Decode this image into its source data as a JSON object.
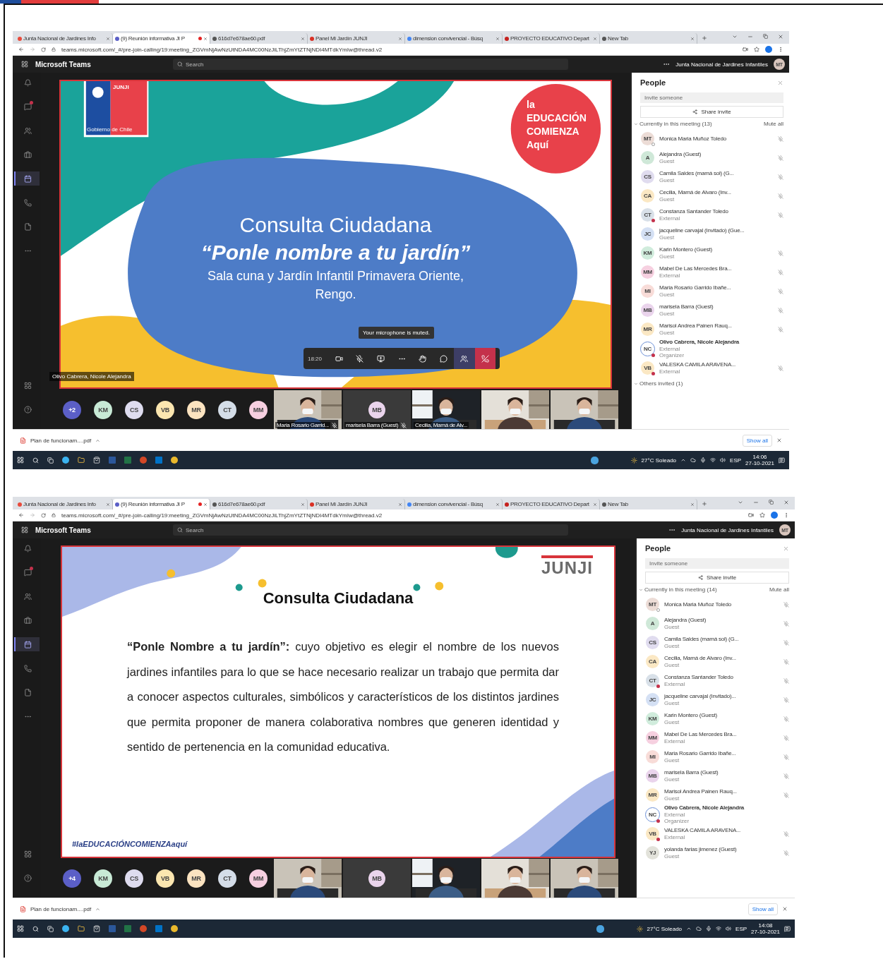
{
  "screens": [
    {
      "tabs": [
        {
          "title": "Junta Nacional de Jardines Info",
          "selected": false,
          "recording": false
        },
        {
          "title": "(9) Reunión informativa JI P",
          "selected": true,
          "recording": true
        },
        {
          "title": "616d7e678ae60.pdf",
          "selected": false,
          "recording": false
        },
        {
          "title": "Panel Mi Jardín JUNJI",
          "selected": false,
          "recording": false
        },
        {
          "title": "dimension convivencial - Búsq",
          "selected": false,
          "recording": false
        },
        {
          "title": "PROYECTO EDUCATIVO Depart",
          "selected": false,
          "recording": false
        },
        {
          "title": "New Tab",
          "selected": false,
          "recording": false
        }
      ],
      "url": "teams.microsoft.com/_#/pre-join-calling/19:meeting_ZGVmNjAwNzUtNDA4MC00NzJiLThjZmYtZTNjNDI4MTdkYmIw@thread.v2",
      "app_title": "Microsoft Teams",
      "search_placeholder": "Search",
      "org": "Junta Nacional de Jardines Infantiles",
      "user_initials": "MT",
      "rail": [
        {
          "kind": "activity",
          "selected": false,
          "badge": false
        },
        {
          "kind": "chat",
          "selected": false,
          "badge": true
        },
        {
          "kind": "teams",
          "selected": false,
          "badge": false
        },
        {
          "kind": "assignments",
          "selected": false,
          "badge": false
        },
        {
          "kind": "calendar",
          "selected": true,
          "badge": false
        },
        {
          "kind": "calls",
          "selected": false,
          "badge": false
        },
        {
          "kind": "files",
          "selected": false,
          "badge": false
        },
        {
          "kind": "more",
          "selected": false,
          "badge": false
        }
      ],
      "rail_bottom": [
        {
          "kind": "apps",
          "selected": false,
          "badge": false
        },
        {
          "kind": "help",
          "selected": false,
          "badge": false
        }
      ],
      "slide": {
        "kind": "cover",
        "logo_title": "JUNJI",
        "logo_caption": "Gobierno de Chile",
        "slogan_lines": [
          "la",
          "EDUCACIÓN",
          "COMIENZA",
          "Aquí"
        ],
        "title": "Consulta Ciudadana",
        "subtitle": "“Ponle nombre a tu jardín”",
        "lines": [
          "Sala cuna y Jardín Infantil Primavera Oriente,",
          "Rengo."
        ]
      },
      "call_controls": {
        "timer": "18:20",
        "toast": "Your microphone is muted."
      },
      "presenter_label": "Olivo Cabrera, Nicole Alejandra",
      "strip": [
        {
          "kind": "overflow",
          "label": "+2"
        },
        {
          "kind": "avatar",
          "initials": "KM",
          "color": "#c8ead6"
        },
        {
          "kind": "avatar",
          "initials": "CS",
          "color": "#dedcef"
        },
        {
          "kind": "avatar",
          "initials": "VB",
          "color": "#fbe6b0"
        },
        {
          "kind": "avatar",
          "initials": "MR",
          "color": "#fbe3c0"
        },
        {
          "kind": "avatar",
          "initials": "CT",
          "color": "#d4dde8"
        },
        {
          "kind": "avatar",
          "initials": "MM",
          "color": "#f6cfe0"
        },
        {
          "kind": "video",
          "label": "Maria Rosario Garrid...",
          "muted": true
        },
        {
          "kind": "avatar_tile",
          "initials": "MB",
          "color": "#ead4ec",
          "label": "marisela Barra (Guest)",
          "muted": true
        },
        {
          "kind": "video",
          "label": "Cecilia, Mamá de Alv...",
          "muted": false
        },
        {
          "kind": "video"
        },
        {
          "kind": "video"
        }
      ],
      "people": {
        "title": "People",
        "invite_placeholder": "Invite someone",
        "share": "Share invite",
        "section": "Currently in this meeting (13)",
        "mute_all": "Mute all",
        "others": "Others invited (1)",
        "participants": [
          {
            "initials": "MT",
            "name": "Monica Maria Muñoz Toledo",
            "color": "#ecdcd6",
            "busy": false,
            "offline": true,
            "muted": true,
            "bold": false
          },
          {
            "initials": "A",
            "name": "Alejandra (Guest)",
            "roles": [
              "Guest"
            ],
            "color": "#cfe8d8",
            "busy": false,
            "offline": false,
            "muted": true,
            "bold": false
          },
          {
            "initials": "CS",
            "name": "Camila Saldes (mamá sol) (G...",
            "roles": [
              "Guest"
            ],
            "color": "#e0dcef",
            "busy": false,
            "offline": false,
            "muted": true,
            "bold": false
          },
          {
            "initials": "CA",
            "name": "Cecilia, Mamá de Alvaro (Inv...",
            "roles": [
              "Guest"
            ],
            "color": "#fbe8c4",
            "busy": false,
            "offline": false,
            "muted": true,
            "bold": false
          },
          {
            "initials": "CT",
            "name": "Constanza Santander Toledo",
            "roles": [
              "External"
            ],
            "color": "#d8e0e8",
            "busy": true,
            "offline": false,
            "muted": true,
            "bold": false
          },
          {
            "initials": "JC",
            "name": "jacqueline carvajal (Invitado) (Gue...",
            "roles": [
              "Guest"
            ],
            "color": "#d4e0f4",
            "busy": false,
            "offline": false,
            "muted": false,
            "bold": false
          },
          {
            "initials": "KM",
            "name": "Karin Montero (Guest)",
            "roles": [
              "Guest"
            ],
            "color": "#d0ecdc",
            "busy": false,
            "offline": false,
            "muted": true,
            "bold": false
          },
          {
            "initials": "MM",
            "name": "Mabel De Las Mercedes Bra...",
            "roles": [
              "External"
            ],
            "color": "#f6d0e0",
            "busy": false,
            "offline": false,
            "muted": true,
            "bold": false
          },
          {
            "initials": "MI",
            "name": "Maria Rosario Garrido Ibañe...",
            "roles": [
              "Guest"
            ],
            "color": "#f8dcd8",
            "busy": false,
            "offline": false,
            "muted": true,
            "bold": false
          },
          {
            "initials": "MB",
            "name": "marisela Barra (Guest)",
            "roles": [
              "Guest"
            ],
            "color": "#ead4ec",
            "busy": false,
            "offline": false,
            "muted": true,
            "bold": false
          },
          {
            "initials": "MR",
            "name": "Marisol Andrea Painen Rauq...",
            "roles": [
              "Guest"
            ],
            "color": "#fbe8c4",
            "busy": false,
            "offline": false,
            "muted": true,
            "bold": false
          },
          {
            "initials": "NC",
            "name": "Olivo Cabrera, Nicole Alejandra",
            "roles": [
              "External",
              "Organizer"
            ],
            "color": "#ffffff",
            "busy": true,
            "offline": false,
            "muted": false,
            "bold": true
          },
          {
            "initials": "VB",
            "name": "VALESKA CAMILA ARAVENA...",
            "roles": [
              "External"
            ],
            "color": "#fbe8c4",
            "busy": true,
            "offline": false,
            "muted": true,
            "bold": false
          }
        ]
      },
      "download": {
        "file": "Plan de funcionam....pdf",
        "show_all": "Show all"
      },
      "taskbar": {
        "weather": "27°C Soleado",
        "lang": "ESP",
        "time": "14:06",
        "date": "27-10-2021"
      }
    },
    {
      "tabs": [
        {
          "title": "Junta Nacional de Jardines Info",
          "selected": false,
          "recording": false
        },
        {
          "title": "(9) Reunión informativa JI P",
          "selected": true,
          "recording": true
        },
        {
          "title": "616d7e678ae60.pdf",
          "selected": false,
          "recording": false
        },
        {
          "title": "Panel Mi Jardín JUNJI",
          "selected": false,
          "recording": false
        },
        {
          "title": "dimension convivencial - Búsq",
          "selected": false,
          "recording": false
        },
        {
          "title": "PROYECTO EDUCATIVO Depart",
          "selected": false,
          "recording": false
        },
        {
          "title": "New Tab",
          "selected": false,
          "recording": false
        }
      ],
      "url": "teams.microsoft.com/_#/pre-join-calling/19:meeting_ZGVmNjAwNzUtNDA4MC00NzJiLThjZmYtZTNjNDI4MTdkYmIw@thread.v2",
      "app_title": "Microsoft Teams",
      "search_placeholder": "Search",
      "org": "Junta Nacional de Jardines Infantiles",
      "user_initials": "MT",
      "rail": [
        {
          "kind": "activity",
          "selected": false,
          "badge": false
        },
        {
          "kind": "chat",
          "selected": false,
          "badge": true
        },
        {
          "kind": "teams",
          "selected": false,
          "badge": false
        },
        {
          "kind": "assignments",
          "selected": false,
          "badge": false
        },
        {
          "kind": "calendar",
          "selected": true,
          "badge": false
        },
        {
          "kind": "calls",
          "selected": false,
          "badge": false
        },
        {
          "kind": "files",
          "selected": false,
          "badge": false
        },
        {
          "kind": "more",
          "selected": false,
          "badge": false
        }
      ],
      "rail_bottom": [
        {
          "kind": "apps",
          "selected": false,
          "badge": false
        },
        {
          "kind": "help",
          "selected": false,
          "badge": false
        }
      ],
      "slide": {
        "kind": "text",
        "logo_title": "JUNJI",
        "title": "Consulta Ciudadana",
        "body": "**“Ponle Nombre a tu jardín”:** cuyo objetivo es elegir el nombre de los nuevos jardines infantiles para lo que se hace necesario realizar un trabajo que permita dar a conocer aspectos culturales, simbólicos y característicos de los distintos jardines que permita proponer de manera colaborativa nombres que generen identidad y sentido de pertenencia en la comunidad educativa.",
        "hashtag": "#laEDUCACIÓNCOMIENZAaquí"
      },
      "strip": [
        {
          "kind": "overflow",
          "label": "+4"
        },
        {
          "kind": "avatar",
          "initials": "KM",
          "color": "#c8ead6"
        },
        {
          "kind": "avatar",
          "initials": "CS",
          "color": "#dedcef"
        },
        {
          "kind": "avatar",
          "initials": "VB",
          "color": "#fbe6b0"
        },
        {
          "kind": "avatar",
          "initials": "MR",
          "color": "#fbe3c0"
        },
        {
          "kind": "avatar",
          "initials": "CT",
          "color": "#d4dde8"
        },
        {
          "kind": "avatar",
          "initials": "MM",
          "color": "#f6cfe0"
        },
        {
          "kind": "video"
        },
        {
          "kind": "avatar_tile",
          "initials": "MB",
          "color": "#ead4ec"
        },
        {
          "kind": "video"
        },
        {
          "kind": "video"
        },
        {
          "kind": "video"
        }
      ],
      "people": {
        "title": "People",
        "invite_placeholder": "Invite someone",
        "share": "Share invite",
        "section": "Currently in this meeting (14)",
        "mute_all": "Mute all",
        "participants": [
          {
            "initials": "MT",
            "name": "Monica Maria Muñoz Toledo",
            "color": "#ecdcd6",
            "busy": false,
            "offline": true,
            "muted": true,
            "bold": false
          },
          {
            "initials": "A",
            "name": "Alejandra (Guest)",
            "roles": [
              "Guest"
            ],
            "color": "#cfe8d8",
            "busy": false,
            "offline": false,
            "muted": true,
            "bold": false
          },
          {
            "initials": "CS",
            "name": "Camila Saldes (mamá sol) (G...",
            "roles": [
              "Guest"
            ],
            "color": "#e0dcef",
            "busy": false,
            "offline": false,
            "muted": true,
            "bold": false
          },
          {
            "initials": "CA",
            "name": "Cecilia, Mamá de Alvaro (Inv...",
            "roles": [
              "Guest"
            ],
            "color": "#fbe8c4",
            "busy": false,
            "offline": false,
            "muted": true,
            "bold": false
          },
          {
            "initials": "CT",
            "name": "Constanza Santander Toledo",
            "roles": [
              "External"
            ],
            "color": "#d8e0e8",
            "busy": true,
            "offline": false,
            "muted": true,
            "bold": false
          },
          {
            "initials": "JC",
            "name": "jacqueline carvajal (Invitado)...",
            "roles": [
              "Guest"
            ],
            "color": "#d4e0f4",
            "busy": false,
            "offline": false,
            "muted": true,
            "bold": false
          },
          {
            "initials": "KM",
            "name": "Karin Montero (Guest)",
            "roles": [
              "Guest"
            ],
            "color": "#d0ecdc",
            "busy": false,
            "offline": false,
            "muted": true,
            "bold": false
          },
          {
            "initials": "MM",
            "name": "Mabel De Las Mercedes Bra...",
            "roles": [
              "External"
            ],
            "color": "#f6d0e0",
            "busy": false,
            "offline": false,
            "muted": true,
            "bold": false
          },
          {
            "initials": "MI",
            "name": "Maria Rosario Garrido Ibañe...",
            "roles": [
              "Guest"
            ],
            "color": "#f8dcd8",
            "busy": false,
            "offline": false,
            "muted": true,
            "bold": false
          },
          {
            "initials": "MB",
            "name": "marisela Barra (Guest)",
            "roles": [
              "Guest"
            ],
            "color": "#ead4ec",
            "busy": false,
            "offline": false,
            "muted": true,
            "bold": false
          },
          {
            "initials": "MR",
            "name": "Marisol Andrea Painen Rauq...",
            "roles": [
              "Guest"
            ],
            "color": "#fbe8c4",
            "busy": false,
            "offline": false,
            "muted": true,
            "bold": false
          },
          {
            "initials": "NC",
            "name": "Olivo Cabrera, Nicole Alejandra",
            "roles": [
              "External",
              "Organizer"
            ],
            "color": "#ffffff",
            "busy": true,
            "offline": false,
            "muted": false,
            "bold": true
          },
          {
            "initials": "VB",
            "name": "VALESKA CAMILA ARAVENA...",
            "roles": [
              "External"
            ],
            "color": "#fbe8c4",
            "busy": true,
            "offline": false,
            "muted": true,
            "bold": false
          },
          {
            "initials": "YJ",
            "name": "yolanda farias jimenez (Guest)",
            "roles": [
              "Guest"
            ],
            "color": "#e2e2da",
            "busy": false,
            "offline": false,
            "muted": true,
            "bold": false
          }
        ]
      },
      "download": {
        "file": "Plan de funcionam....pdf",
        "show_all": "Show all"
      },
      "taskbar": {
        "weather": "27°C Soleado",
        "lang": "ESP",
        "time": "14:08",
        "date": "27-10-2021"
      }
    }
  ]
}
